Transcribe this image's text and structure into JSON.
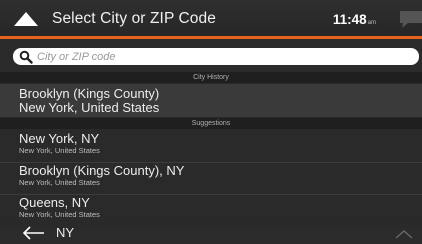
{
  "header": {
    "title": "Select City or ZIP Code",
    "time": "11:48",
    "ampm": "am"
  },
  "search": {
    "placeholder": "City or ZIP code",
    "value": ""
  },
  "sections": {
    "history_label": "City History",
    "suggestions_label": "Suggestions"
  },
  "history": [
    {
      "primary": "Brooklyn (Kings County)",
      "secondary": "New York, United States"
    }
  ],
  "suggestions": [
    {
      "primary": "New York, NY",
      "secondary": "New York, United States"
    },
    {
      "primary": "Brooklyn (Kings County), NY",
      "secondary": "New York, United States"
    },
    {
      "primary": "Queens, NY",
      "secondary": "New York, United States"
    }
  ],
  "bottom": {
    "partial_item": "NY"
  },
  "colors": {
    "accent": "#e8621f",
    "background": "#2a2a2a",
    "history_row": "#3a3a3a"
  },
  "icons": [
    "up-arrow-icon",
    "message-icon",
    "search-icon",
    "back-arrow-icon",
    "chevron-up-icon"
  ]
}
